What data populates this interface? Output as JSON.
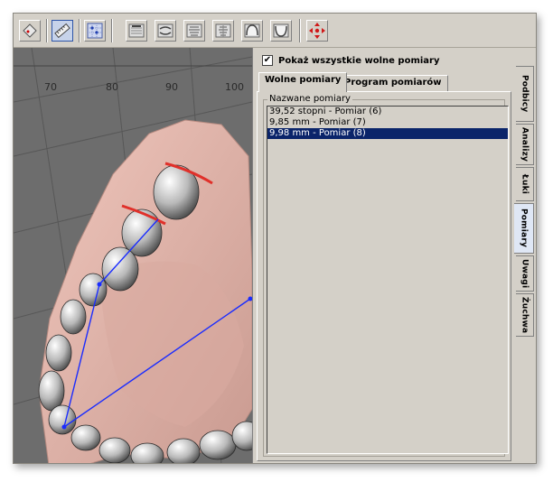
{
  "toolbar": {
    "buttons": [
      {
        "name": "view-front-icon"
      },
      {
        "name": "measure-ruler-icon",
        "active": true
      },
      {
        "name": "grid-dots-icon"
      },
      {
        "name": "occlusion-view-1-icon"
      },
      {
        "name": "occlusion-view-2-icon"
      },
      {
        "name": "occlusion-view-3-icon"
      },
      {
        "name": "occlusion-view-4-icon"
      },
      {
        "name": "arch-view-icon"
      },
      {
        "name": "lower-arch-view-icon"
      },
      {
        "name": "move-points-icon"
      }
    ]
  },
  "viewport": {
    "ruler": [
      "70",
      "80",
      "90",
      "100"
    ],
    "colors": {
      "background": "#6d6d6d",
      "gum": "#e3b6ad",
      "measure_line": "#1a2cff",
      "mark": "#e0302a"
    }
  },
  "panel": {
    "show_all_label": "Pokaż wszystkie wolne pomiary",
    "show_all_checked": true,
    "check_mark": "✔",
    "tabs": [
      {
        "label": "Wolne pomiary",
        "active": true
      },
      {
        "label": "Program pomiarów",
        "active": false
      }
    ],
    "group_title": "Nazwane pomiary",
    "items": [
      {
        "label": "39,52 stopni - Pomiar (6)",
        "selected": false
      },
      {
        "label": "9,85 mm - Pomiar (7)",
        "selected": false
      },
      {
        "label": "9,98 mm - Pomiar (8)",
        "selected": true
      }
    ]
  },
  "side_tabs": [
    {
      "label": "Podbicy",
      "active": false
    },
    {
      "label": "Analizy",
      "active": false
    },
    {
      "label": "Łuki",
      "active": false
    },
    {
      "label": "Pomiary",
      "active": true
    },
    {
      "label": "Uwagi",
      "active": false
    },
    {
      "label": "Żuchwa",
      "active": false
    }
  ]
}
